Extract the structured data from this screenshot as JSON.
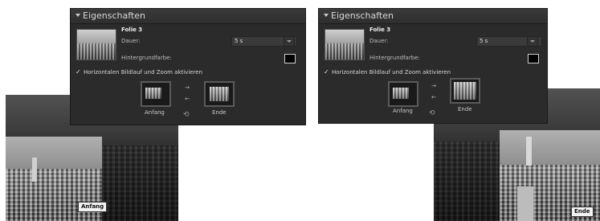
{
  "panel": {
    "title": "Eigenschaften",
    "slide_name": "Folie 3",
    "duration_label": "Dauer:",
    "duration_value": "5 s",
    "bg_label": "Hintergrundfarbe:",
    "bg_color": "#000000",
    "checkbox_label": "Horizontalen Bildlauf und Zoom aktivieren",
    "checked": true,
    "start_label": "Anfang",
    "end_label": "Ende"
  },
  "preview_left": {
    "tag": "Anfang"
  },
  "preview_right": {
    "tag": "Ende"
  },
  "icons": {
    "checkmark": "✓",
    "swap_right": "→",
    "swap_left": "←",
    "cycle": "⟲"
  }
}
